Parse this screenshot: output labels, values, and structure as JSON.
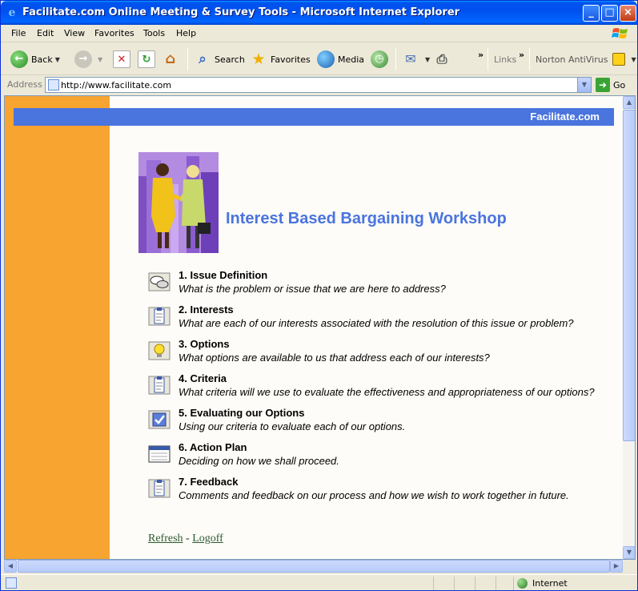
{
  "window": {
    "title": "Facilitate.com Online Meeting & Survey Tools - Microsoft Internet Explorer",
    "minimize": "_",
    "maximize": "□",
    "close": "×"
  },
  "menu": [
    "File",
    "Edit",
    "View",
    "Favorites",
    "Tools",
    "Help"
  ],
  "toolbar": {
    "back": "Back",
    "search": "Search",
    "favorites": "Favorites",
    "media": "Media",
    "more": "»",
    "links": "Links",
    "norton": "Norton AntiVirus"
  },
  "address": {
    "label": "Address",
    "url": "http://www.facilitate.com",
    "go": "Go"
  },
  "page": {
    "brand": "Facilitate.com",
    "title": "Interest Based Bargaining Workshop",
    "steps": [
      {
        "title": "1. Issue Definition",
        "desc": "What is the problem or issue that we are here to address?",
        "icon": "speech-bubbles-icon"
      },
      {
        "title": "2. Interests",
        "desc": "What are each of our interests associated with the resolution of this issue or problem?",
        "icon": "clipboard-icon"
      },
      {
        "title": "3. Options",
        "desc": "What options are available to us that address each of our interests?",
        "icon": "lightbulb-icon"
      },
      {
        "title": "4. Criteria",
        "desc": "What criteria will we use to evaluate the effectiveness and appropriateness of our options?",
        "icon": "clipboard-icon"
      },
      {
        "title": "5. Evaluating our Options",
        "desc": "Using our criteria to evaluate each of our options.",
        "icon": "checkbox-icon"
      },
      {
        "title": "6. Action Plan",
        "desc": "Deciding on how we shall proceed.",
        "icon": "calendar-icon"
      },
      {
        "title": "7. Feedback",
        "desc": "Comments and feedback on our process and how we wish to work together in future.",
        "icon": "clipboard-icon"
      }
    ],
    "refresh": "Refresh",
    "separator": " - ",
    "logoff": "Logoff"
  },
  "status": {
    "zone": "Internet"
  },
  "colors": {
    "brand_blue": "#4A74DE",
    "left_strip": "#F7A430"
  }
}
